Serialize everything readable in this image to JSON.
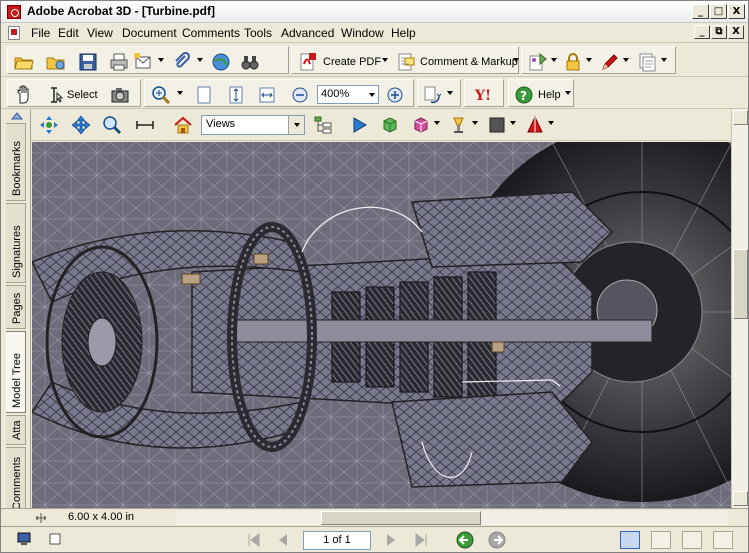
{
  "window": {
    "title": "Adobe Acrobat 3D - [Turbine.pdf]",
    "controls": [
      "_",
      "□",
      "X"
    ],
    "doc_controls": [
      "_",
      "⧉",
      "X"
    ]
  },
  "menubar": {
    "items": [
      "File",
      "Edit",
      "View",
      "Document",
      "Comments",
      "Tools",
      "Advanced",
      "Window",
      "Help"
    ]
  },
  "toolbar1": {
    "create_pdf": "Create PDF",
    "comment_markup": "Comment & Markup"
  },
  "toolbar2": {
    "select": "Select",
    "zoom": "400%",
    "help": "Help"
  },
  "toolbar3d": {
    "views": "Views"
  },
  "navpane": {
    "tabs": [
      "Bookmarks",
      "Signatures",
      "Pages",
      "Model Tree",
      "Atta",
      "Comments"
    ]
  },
  "docbar": {
    "size": "6.00 x 4.00 in"
  },
  "statusbar": {
    "page": "1 of 1"
  }
}
